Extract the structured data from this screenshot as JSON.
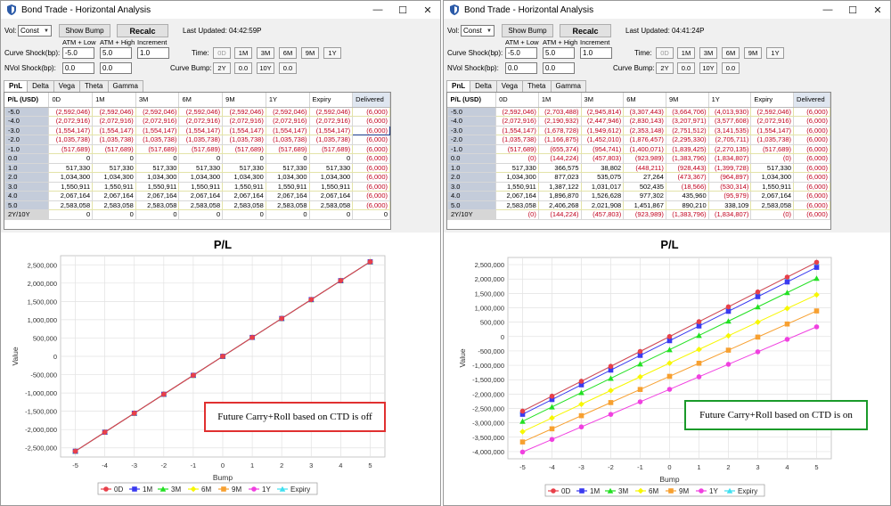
{
  "left": {
    "title": "Bond Trade - Horizontal Analysis",
    "controls": {
      "vol_label": "Vol:",
      "vol_value": "Const",
      "show_bump": "Show Bump",
      "recalc": "Recalc",
      "last_updated": "Last Updated: 04:42:59P",
      "atm_low": "ATM + Low",
      "atm_high": "ATM + High",
      "increment": "Increment",
      "curve_shock_label": "Curve Shock(bp):",
      "curve_low": "-5.0",
      "curve_high": "5.0",
      "curve_inc": "1.0",
      "nvol_label": "NVol Shock(bp):",
      "nvol_low": "0.0",
      "nvol_high": "0.0",
      "time_label": "Time:",
      "time_buttons": [
        "0D",
        "1M",
        "3M",
        "6M",
        "9M",
        "1Y"
      ],
      "curve_bump_label": "Curve Bump:",
      "bump_buttons": [
        "2Y",
        "0.0",
        "10Y",
        "0.0"
      ]
    },
    "tabs": [
      "PnL",
      "Delta",
      "Vega",
      "Theta",
      "Gamma"
    ],
    "grid": {
      "columns": [
        "P/L (USD)",
        "0D",
        "1M",
        "3M",
        "6M",
        "9M",
        "1Y",
        "Expiry",
        "Delivered"
      ],
      "rows": [
        {
          "label": "-5.0",
          "cells": [
            "(2,592,046)",
            "(2,592,046)",
            "(2,592,046)",
            "(2,592,046)",
            "(2,592,046)",
            "(2,592,046)",
            "(2,592,046)",
            "(6,000)"
          ]
        },
        {
          "label": "-4.0",
          "cells": [
            "(2,072,916)",
            "(2,072,916)",
            "(2,072,916)",
            "(2,072,916)",
            "(2,072,916)",
            "(2,072,916)",
            "(2,072,916)",
            "(6,000)"
          ]
        },
        {
          "label": "-3.0",
          "cells": [
            "(1,554,147)",
            "(1,554,147)",
            "(1,554,147)",
            "(1,554,147)",
            "(1,554,147)",
            "(1,554,147)",
            "(1,554,147)",
            "(6,000)"
          ]
        },
        {
          "label": "-2.0",
          "cells": [
            "(1,035,738)",
            "(1,035,738)",
            "(1,035,738)",
            "(1,035,738)",
            "(1,035,738)",
            "(1,035,738)",
            "(1,035,738)",
            "(6,000)"
          ]
        },
        {
          "label": "-1.0",
          "cells": [
            "(517,689)",
            "(517,689)",
            "(517,689)",
            "(517,689)",
            "(517,689)",
            "(517,689)",
            "(517,689)",
            "(6,000)"
          ]
        },
        {
          "label": "0.0",
          "cells": [
            "0",
            "0",
            "0",
            "0",
            "0",
            "0",
            "0",
            "(6,000)"
          ]
        },
        {
          "label": "1.0",
          "cells": [
            "517,330",
            "517,330",
            "517,330",
            "517,330",
            "517,330",
            "517,330",
            "517,330",
            "(6,000)"
          ]
        },
        {
          "label": "2.0",
          "cells": [
            "1,034,300",
            "1,034,300",
            "1,034,300",
            "1,034,300",
            "1,034,300",
            "1,034,300",
            "1,034,300",
            "(6,000)"
          ]
        },
        {
          "label": "3.0",
          "cells": [
            "1,550,911",
            "1,550,911",
            "1,550,911",
            "1,550,911",
            "1,550,911",
            "1,550,911",
            "1,550,911",
            "(6,000)"
          ]
        },
        {
          "label": "4.0",
          "cells": [
            "2,067,164",
            "2,067,164",
            "2,067,164",
            "2,067,164",
            "2,067,164",
            "2,067,164",
            "2,067,164",
            "(6,000)"
          ]
        },
        {
          "label": "5.0",
          "cells": [
            "2,583,058",
            "2,583,058",
            "2,583,058",
            "2,583,058",
            "2,583,058",
            "2,583,058",
            "2,583,058",
            "(6,000)"
          ]
        },
        {
          "label": "2Y/10Y",
          "cells": [
            "0",
            "0",
            "0",
            "0",
            "0",
            "0",
            "0",
            "0"
          ]
        }
      ]
    },
    "note": "Future Carry+Roll based on CTD is off",
    "note_color": "#e03030"
  },
  "right": {
    "title": "Bond Trade - Horizontal Analysis",
    "controls": {
      "vol_label": "Vol:",
      "vol_value": "Const",
      "show_bump": "Show Bump",
      "recalc": "Recalc",
      "last_updated": "Last Updated: 04:41:24P",
      "atm_low": "ATM + Low",
      "atm_high": "ATM + High",
      "increment": "Increment",
      "curve_shock_label": "Curve Shock(bp):",
      "curve_low": "-5.0",
      "curve_high": "5.0",
      "curve_inc": "1.0",
      "nvol_label": "NVol Shock(bp):",
      "nvol_low": "0.0",
      "nvol_high": "0.0",
      "time_label": "Time:",
      "time_buttons": [
        "0D",
        "1M",
        "3M",
        "6M",
        "9M",
        "1Y"
      ],
      "curve_bump_label": "Curve Bump:",
      "bump_buttons": [
        "2Y",
        "0.0",
        "10Y",
        "0.0"
      ]
    },
    "tabs": [
      "PnL",
      "Delta",
      "Vega",
      "Theta",
      "Gamma"
    ],
    "grid": {
      "columns": [
        "P/L (USD)",
        "0D",
        "1M",
        "3M",
        "6M",
        "9M",
        "1Y",
        "Expiry",
        "Delivered"
      ],
      "rows": [
        {
          "label": "-5.0",
          "cells": [
            "(2,592,046)",
            "(2,703,488)",
            "(2,945,814)",
            "(3,307,443)",
            "(3,664,706)",
            "(4,013,930)",
            "(2,592,046)",
            "(6,000)"
          ]
        },
        {
          "label": "-4.0",
          "cells": [
            "(2,072,916)",
            "(2,190,932)",
            "(2,447,946)",
            "(2,830,143)",
            "(3,207,971)",
            "(3,577,608)",
            "(2,072,916)",
            "(6,000)"
          ]
        },
        {
          "label": "-3.0",
          "cells": [
            "(1,554,147)",
            "(1,678,728)",
            "(1,949,612)",
            "(2,353,148)",
            "(2,751,512)",
            "(3,141,535)",
            "(1,554,147)",
            "(6,000)"
          ]
        },
        {
          "label": "-2.0",
          "cells": [
            "(1,035,738)",
            "(1,166,875)",
            "(1,452,010)",
            "(1,876,457)",
            "(2,295,330)",
            "(2,705,711)",
            "(1,035,738)",
            "(6,000)"
          ]
        },
        {
          "label": "-1.0",
          "cells": [
            "(517,689)",
            "(655,374)",
            "(954,741)",
            "(1,400,071)",
            "(1,839,425)",
            "(2,270,135)",
            "(517,689)",
            "(6,000)"
          ]
        },
        {
          "label": "0.0",
          "cells": [
            "(0)",
            "(144,224)",
            "(457,803)",
            "(923,989)",
            "(1,383,796)",
            "(1,834,807)",
            "(0)",
            "(6,000)"
          ]
        },
        {
          "label": "1.0",
          "cells": [
            "517,330",
            "366,575",
            "38,802",
            "(448,211)",
            "(928,443)",
            "(1,399,728)",
            "517,330",
            "(6,000)"
          ]
        },
        {
          "label": "2.0",
          "cells": [
            "1,034,300",
            "877,023",
            "535,075",
            "27,264",
            "(473,367)",
            "(964,897)",
            "1,034,300",
            "(6,000)"
          ]
        },
        {
          "label": "3.0",
          "cells": [
            "1,550,911",
            "1,387,122",
            "1,031,017",
            "502,435",
            "(18,566)",
            "(530,314)",
            "1,550,911",
            "(6,000)"
          ]
        },
        {
          "label": "4.0",
          "cells": [
            "2,067,164",
            "1,896,870",
            "1,526,628",
            "977,302",
            "435,960",
            "(95,979)",
            "2,067,164",
            "(6,000)"
          ]
        },
        {
          "label": "5.0",
          "cells": [
            "2,583,058",
            "2,406,268",
            "2,021,908",
            "1,451,867",
            "890,210",
            "338,109",
            "2,583,058",
            "(6,000)"
          ]
        },
        {
          "label": "2Y/10Y",
          "cells": [
            "(0)",
            "(144,224)",
            "(457,803)",
            "(923,989)",
            "(1,383,796)",
            "(1,834,807)",
            "(0)",
            "(6,000)"
          ]
        }
      ]
    },
    "note": "Future Carry+Roll based on CTD is on",
    "note_color": "#1a9a2a"
  },
  "series_colors": [
    "#e8404a",
    "#3a3af0",
    "#22e022",
    "#f7f700",
    "#f7a030",
    "#f040e0",
    "#40e0f0"
  ],
  "chart_data": [
    {
      "type": "line",
      "title": "P/L",
      "xlabel": "Bump",
      "ylabel": "Value",
      "x": [
        -5,
        -4,
        -3,
        -2,
        -1,
        0,
        1,
        2,
        3,
        4,
        5
      ],
      "xlim": [
        -5.5,
        5.5
      ],
      "ylim": [
        -2750000,
        2750000
      ],
      "yticks": [
        -2500000,
        -2000000,
        -1500000,
        -1000000,
        -500000,
        0,
        500000,
        1000000,
        1500000,
        2000000,
        2500000
      ],
      "ytick_labels": [
        "-2,500,000",
        "-2,000,000",
        "-1,500,000",
        "-1,000,000",
        "-500,000",
        "0",
        "500,000",
        "1,000,000",
        "1,500,000",
        "2,000,000",
        "2,500,000"
      ],
      "legend_placement": "bottom",
      "series": [
        {
          "name": "0D",
          "values": [
            -2592046,
            -2072916,
            -1554147,
            -1035738,
            -517689,
            0,
            517330,
            1034300,
            1550911,
            2067164,
            2583058
          ]
        },
        {
          "name": "1M",
          "values": [
            -2592046,
            -2072916,
            -1554147,
            -1035738,
            -517689,
            0,
            517330,
            1034300,
            1550911,
            2067164,
            2583058
          ]
        },
        {
          "name": "3M",
          "values": [
            -2592046,
            -2072916,
            -1554147,
            -1035738,
            -517689,
            0,
            517330,
            1034300,
            1550911,
            2067164,
            2583058
          ]
        },
        {
          "name": "6M",
          "values": [
            -2592046,
            -2072916,
            -1554147,
            -1035738,
            -517689,
            0,
            517330,
            1034300,
            1550911,
            2067164,
            2583058
          ]
        },
        {
          "name": "9M",
          "values": [
            -2592046,
            -2072916,
            -1554147,
            -1035738,
            -517689,
            0,
            517330,
            1034300,
            1550911,
            2067164,
            2583058
          ]
        },
        {
          "name": "1Y",
          "values": [
            -2592046,
            -2072916,
            -1554147,
            -1035738,
            -517689,
            0,
            517330,
            1034300,
            1550911,
            2067164,
            2583058
          ]
        },
        {
          "name": "Expiry",
          "values": [
            -2592046,
            -2072916,
            -1554147,
            -1035738,
            -517689,
            0,
            517330,
            1034300,
            1550911,
            2067164,
            2583058
          ]
        }
      ]
    },
    {
      "type": "line",
      "title": "P/L",
      "xlabel": "Bump",
      "ylabel": "Value",
      "x": [
        -5,
        -4,
        -3,
        -2,
        -1,
        0,
        1,
        2,
        3,
        4,
        5
      ],
      "xlim": [
        -5.5,
        5.5
      ],
      "ylim": [
        -4250000,
        2750000
      ],
      "yticks": [
        -4000000,
        -3500000,
        -3000000,
        -2500000,
        -2000000,
        -1500000,
        -1000000,
        -500000,
        0,
        500000,
        1000000,
        1500000,
        2000000,
        2500000
      ],
      "ytick_labels": [
        "-4,000,000",
        "-3,500,000",
        "-3,000,000",
        "-2,500,000",
        "-2,000,000",
        "-1,500,000",
        "-1,000,000",
        "-500,000",
        "0",
        "500,000",
        "1,000,000",
        "1,500,000",
        "2,000,000",
        "2,500,000"
      ],
      "legend_placement": "bottom",
      "series": [
        {
          "name": "0D",
          "values": [
            -2592046,
            -2072916,
            -1554147,
            -1035738,
            -517689,
            0,
            517330,
            1034300,
            1550911,
            2067164,
            2583058
          ]
        },
        {
          "name": "1M",
          "values": [
            -2703488,
            -2190932,
            -1678728,
            -1166875,
            -655374,
            -144224,
            366575,
            877023,
            1387122,
            1896870,
            2406268
          ]
        },
        {
          "name": "3M",
          "values": [
            -2945814,
            -2447946,
            -1949612,
            -1452010,
            -954741,
            -457803,
            38802,
            535075,
            1031017,
            1526628,
            2021908
          ]
        },
        {
          "name": "6M",
          "values": [
            -3307443,
            -2830143,
            -2353148,
            -1876457,
            -1400071,
            -923989,
            -448211,
            27264,
            502435,
            977302,
            1451867
          ]
        },
        {
          "name": "9M",
          "values": [
            -3664706,
            -3207971,
            -2751512,
            -2295330,
            -1839425,
            -1383796,
            -928443,
            -473367,
            -18566,
            435960,
            890210
          ]
        },
        {
          "name": "1Y",
          "values": [
            -4013930,
            -3577608,
            -3141535,
            -2705711,
            -2270135,
            -1834807,
            -1399728,
            -964897,
            -530314,
            -95979,
            338109
          ]
        },
        {
          "name": "Expiry",
          "values": [
            -2592046,
            -2072916,
            -1554147,
            -1035738,
            -517689,
            0,
            517330,
            1034300,
            1550911,
            2067164,
            2583058
          ]
        }
      ]
    }
  ]
}
